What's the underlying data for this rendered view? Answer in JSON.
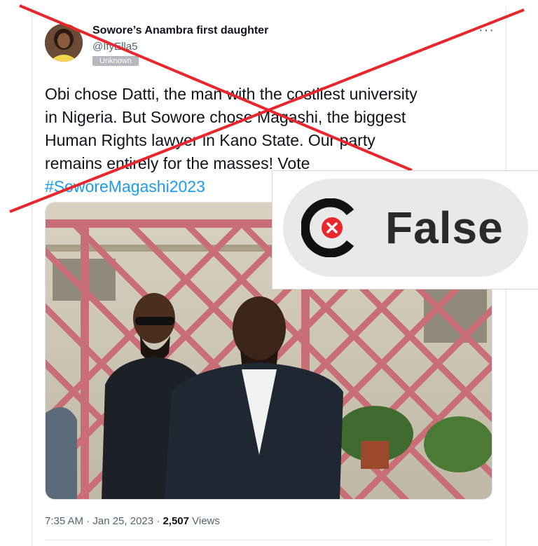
{
  "tweet": {
    "author": {
      "display_name": "Sowore’s Anambra first daughter",
      "handle": "@IfyElla5",
      "badge": "Unknown"
    },
    "more_icon": "more-horizontal-icon",
    "text_lines": [
      "Obi chose Datti, the man with the costliest university",
      "in Nigeria. But Sowore chose Magashi, the biggest",
      "Human Rights lawyer in Kano State. Our party",
      "remains entirely for the masses! Vote"
    ],
    "hashtag": "#SoworeMagashi2023",
    "timestamp": "7:35 AM · Jan 25, 2023 · ",
    "views_count": "2,507",
    "views_label": " Views"
  },
  "verdict": {
    "label": "False",
    "logo_icon": "false-rating-logo-icon"
  },
  "colors": {
    "cross_red": "#e8262b",
    "hashtag_blue": "#1d9bf0",
    "lattice_pink": "#c96d76",
    "logo_red": "#e8262b"
  }
}
